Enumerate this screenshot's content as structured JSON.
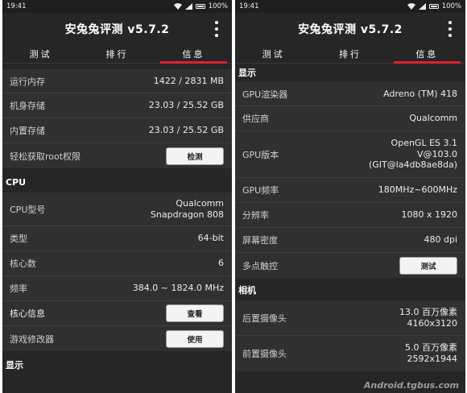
{
  "status_bar": {
    "time": "19:41",
    "battery": "100%"
  },
  "app": {
    "title": "安兔兔评测 v5.7.2"
  },
  "tabs": [
    {
      "label": "测试"
    },
    {
      "label": "排行"
    },
    {
      "label": "信息"
    }
  ],
  "left": {
    "memory": [
      {
        "label": "运行内存",
        "value": "1422 / 2831 MB"
      },
      {
        "label": "机身存储",
        "value": "23.03 / 25.52 GB"
      },
      {
        "label": "内置存储",
        "value": "23.03 / 25.52 GB"
      }
    ],
    "root": {
      "label": "轻松获取root权限",
      "button": "检测"
    },
    "cpu_header": "CPU",
    "cpu": {
      "model_label": "CPU型号",
      "model_line1": "Qualcomm",
      "model_line2": "Snapdragon 808",
      "type_label": "类型",
      "type_value": "64-bit",
      "cores_label": "核心数",
      "cores_value": "6",
      "freq_label": "频率",
      "freq_value": "384.0 ~ 1824.0 MHz",
      "core_info_label": "核心信息",
      "core_info_button": "查看",
      "game_label": "游戏修改器",
      "game_button": "使用"
    },
    "display_header": "显示"
  },
  "right": {
    "display_header": "显示",
    "display": {
      "gpu_renderer_label": "GPU渲染器",
      "gpu_renderer_value": "Adreno (TM) 418",
      "vendor_label": "供应商",
      "vendor_value": "Qualcomm",
      "gpu_version_label": "GPU版本",
      "gpu_version_line1": "OpenGL ES 3.1",
      "gpu_version_line2": "V@103.0",
      "gpu_version_line3": "(GIT@la4db8ae8da)",
      "gpu_freq_label": "GPU频率",
      "gpu_freq_value": "180MHz~600MHz",
      "resolution_label": "分辨率",
      "resolution_value": "1080 x 1920",
      "density_label": "屏幕密度",
      "density_value": "480 dpi",
      "multitouch_label": "多点触控",
      "multitouch_button": "测试"
    },
    "camera_header": "相机",
    "camera": {
      "rear_label": "后置摄像头",
      "rear_line1": "13.0 百万像素",
      "rear_line2": "4160x3120",
      "front_label": "前置摄像头",
      "front_line1": "5.0 百万像素",
      "front_line2": "2592x1944"
    },
    "watermark": "Android.tgbus.com"
  },
  "colors": {
    "tab_indicator": "#e0202e",
    "background": "#262626",
    "card": "#303030"
  }
}
